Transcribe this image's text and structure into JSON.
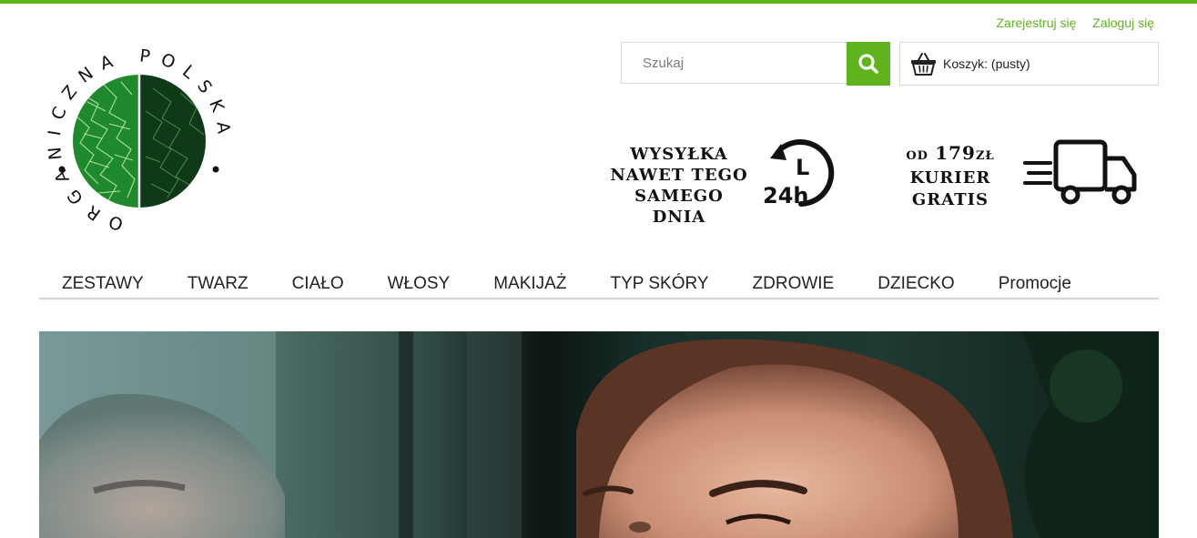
{
  "colors": {
    "accent": "#5fb41e",
    "text": "#222222",
    "border": "#d9d9d9"
  },
  "header": {
    "user_links": {
      "register": "Zarejestruj się",
      "login": "Zaloguj się"
    },
    "logo": {
      "text": "ORGANICZNA POLSKA",
      "icon": "leaf-logo"
    },
    "search": {
      "placeholder": "Szukaj",
      "icon": "search-icon"
    },
    "cart": {
      "label": "Koszyk: (pusty)",
      "icon": "basket-icon"
    }
  },
  "promos": {
    "shipping": {
      "line1": "WYSYŁKA",
      "line2": "NAWET TEGO",
      "line3": "SAMEGO DNIA",
      "badge": "24h",
      "icon": "clock-24h-icon"
    },
    "courier": {
      "prefix": "OD",
      "amount": "179",
      "currency": "ZŁ",
      "line2": "KURIER",
      "line3": "GRATIS",
      "icon": "delivery-truck-icon"
    }
  },
  "nav": {
    "items": [
      "ZESTAWY",
      "TWARZ",
      "CIAŁO",
      "WŁOSY",
      "MAKIJAŻ",
      "TYP SKÓRY",
      "ZDROWIE",
      "DZIECKO",
      "Promocje"
    ]
  },
  "hero": {
    "image": "woman-portrait-banner"
  }
}
